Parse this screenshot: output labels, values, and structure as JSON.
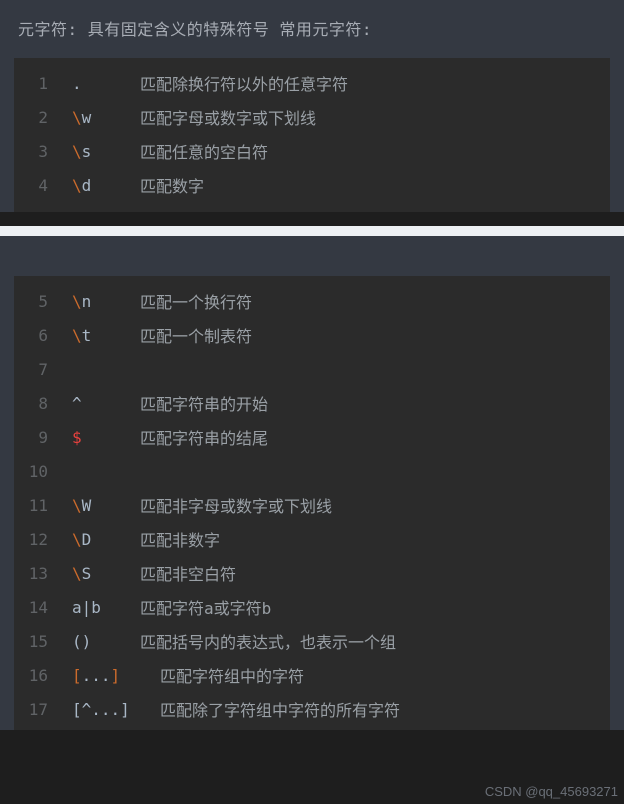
{
  "header": "元字符: 具有固定含义的特殊符号 常用元字符:",
  "watermark": "CSDN @qq_45693271",
  "block1": [
    {
      "n": "1",
      "sym": [
        {
          "t": ".",
          "c": "c-plain"
        }
      ],
      "desc": "匹配除换行符以外的任意字符"
    },
    {
      "n": "2",
      "sym": [
        {
          "t": "\\",
          "c": "c-bs"
        },
        {
          "t": "w",
          "c": "c-let"
        }
      ],
      "desc": "匹配字母或数字或下划线"
    },
    {
      "n": "3",
      "sym": [
        {
          "t": "\\",
          "c": "c-bs"
        },
        {
          "t": "s",
          "c": "c-let"
        }
      ],
      "desc": "匹配任意的空白符"
    },
    {
      "n": "4",
      "sym": [
        {
          "t": "\\",
          "c": "c-bs"
        },
        {
          "t": "d",
          "c": "c-let"
        }
      ],
      "desc": "匹配数字"
    }
  ],
  "block2": [
    {
      "n": "5",
      "sym": [
        {
          "t": "\\",
          "c": "c-bs"
        },
        {
          "t": "n",
          "c": "c-let"
        }
      ],
      "desc": "匹配一个换行符"
    },
    {
      "n": "6",
      "sym": [
        {
          "t": "\\",
          "c": "c-bs"
        },
        {
          "t": "t",
          "c": "c-let"
        }
      ],
      "desc": "匹配一个制表符"
    },
    {
      "n": "7",
      "sym": [],
      "desc": ""
    },
    {
      "n": "8",
      "sym": [
        {
          "t": "^",
          "c": "c-plain"
        }
      ],
      "desc": "匹配字符串的开始"
    },
    {
      "n": "9",
      "sym": [
        {
          "t": "$",
          "c": "c-dollar"
        }
      ],
      "desc": "匹配字符串的结尾"
    },
    {
      "n": "10",
      "sym": [],
      "desc": ""
    },
    {
      "n": "11",
      "sym": [
        {
          "t": "\\",
          "c": "c-bs"
        },
        {
          "t": "W",
          "c": "c-let"
        }
      ],
      "desc": "匹配非字母或数字或下划线"
    },
    {
      "n": "12",
      "sym": [
        {
          "t": "\\",
          "c": "c-bs"
        },
        {
          "t": "D",
          "c": "c-let"
        }
      ],
      "desc": "匹配非数字"
    },
    {
      "n": "13",
      "sym": [
        {
          "t": "\\",
          "c": "c-bs"
        },
        {
          "t": "S",
          "c": "c-let"
        }
      ],
      "desc": "匹配非空白符"
    },
    {
      "n": "14",
      "sym": [
        {
          "t": "a|b",
          "c": "c-plain"
        }
      ],
      "desc": "匹配字符a或字符b"
    },
    {
      "n": "15",
      "sym": [
        {
          "t": "()",
          "c": "c-plain"
        }
      ],
      "desc": "匹配括号内的表达式，也表示一个组"
    },
    {
      "n": "16",
      "sym": [
        {
          "t": "[",
          "c": "c-br"
        },
        {
          "t": "...",
          "c": "c-dots"
        },
        {
          "t": "]",
          "c": "c-br"
        }
      ],
      "desc": "匹配字符组中的字符",
      "indent": true
    },
    {
      "n": "17",
      "sym": [
        {
          "t": "[^...]",
          "c": "c-plain"
        }
      ],
      "desc": "匹配除了字符组中字符的所有字符",
      "indent": true
    }
  ]
}
